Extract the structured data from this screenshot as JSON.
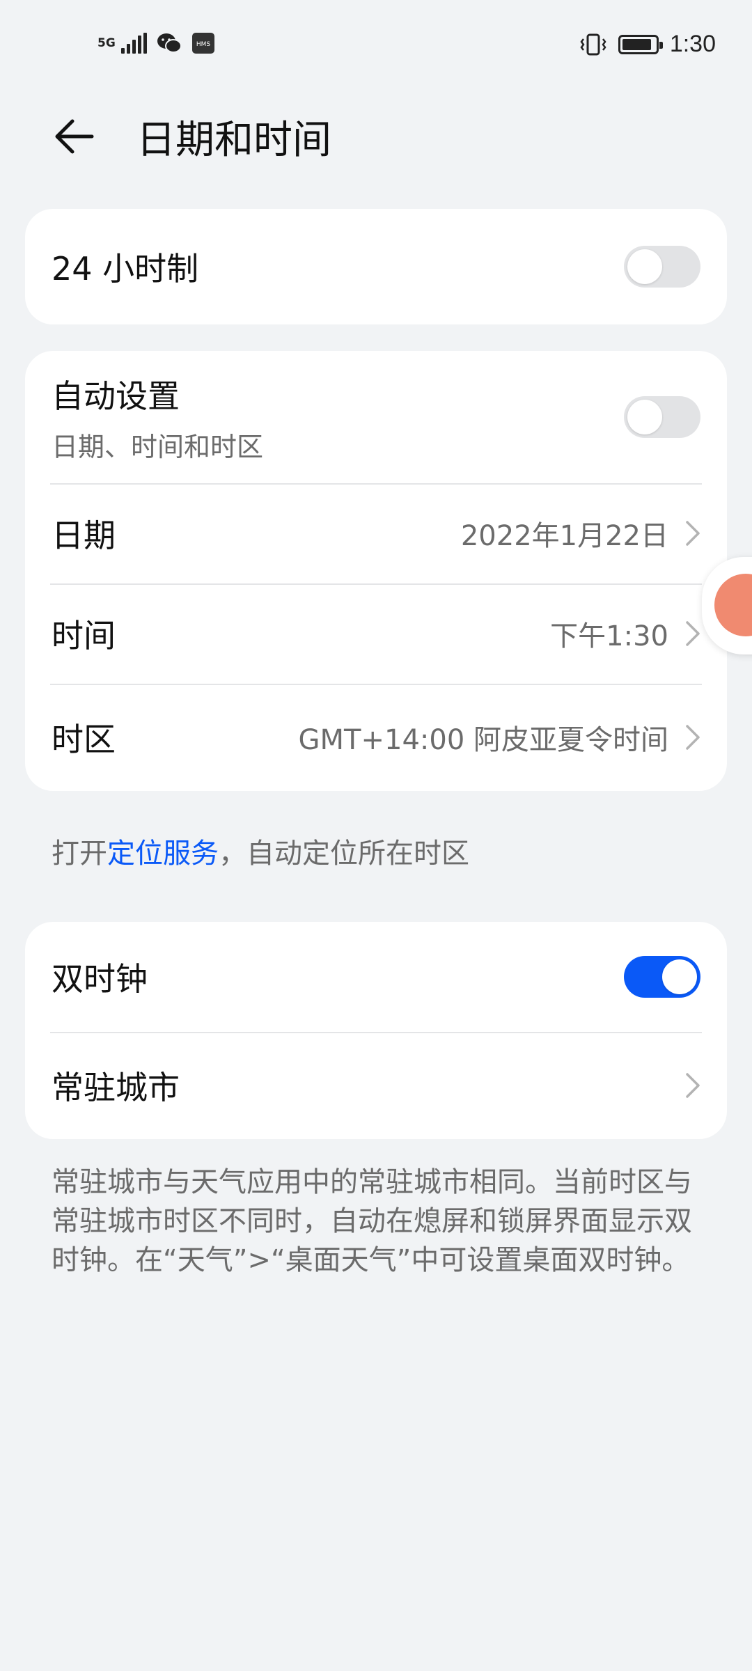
{
  "status_bar": {
    "network": "5G",
    "app_icons": [
      "wechat-icon",
      "hms-icon"
    ],
    "hms_label": "HMS",
    "time": "1:30",
    "battery_level": 0.9
  },
  "header": {
    "title": "日期和时间"
  },
  "card24": {
    "label": "24 小时制",
    "toggle_on": false
  },
  "auto_card": {
    "auto_label": "自动设置",
    "auto_sub": "日期、时间和时区",
    "auto_toggle_on": false,
    "date_label": "日期",
    "date_value": "2022年1月22日",
    "time_label": "时间",
    "time_value": "下午1:30",
    "tz_label": "时区",
    "tz_value": "GMT+14:00 阿皮亚夏令时间"
  },
  "location_note": {
    "prefix": "打开",
    "link": "定位服务",
    "suffix": "，自动定位所在时区"
  },
  "dual_card": {
    "dual_label": "双时钟",
    "dual_toggle_on": true,
    "city_label": "常驻城市"
  },
  "dual_note": "常驻城市与天气应用中的常驻城市相同。当前时区与常驻城市时区不同时，自动在熄屏和锁屏界面显示双时钟。在“天气”>“桌面天气”中可设置桌面双时钟。",
  "colors": {
    "accent": "#0a59f7",
    "background": "#f1f3f5"
  }
}
